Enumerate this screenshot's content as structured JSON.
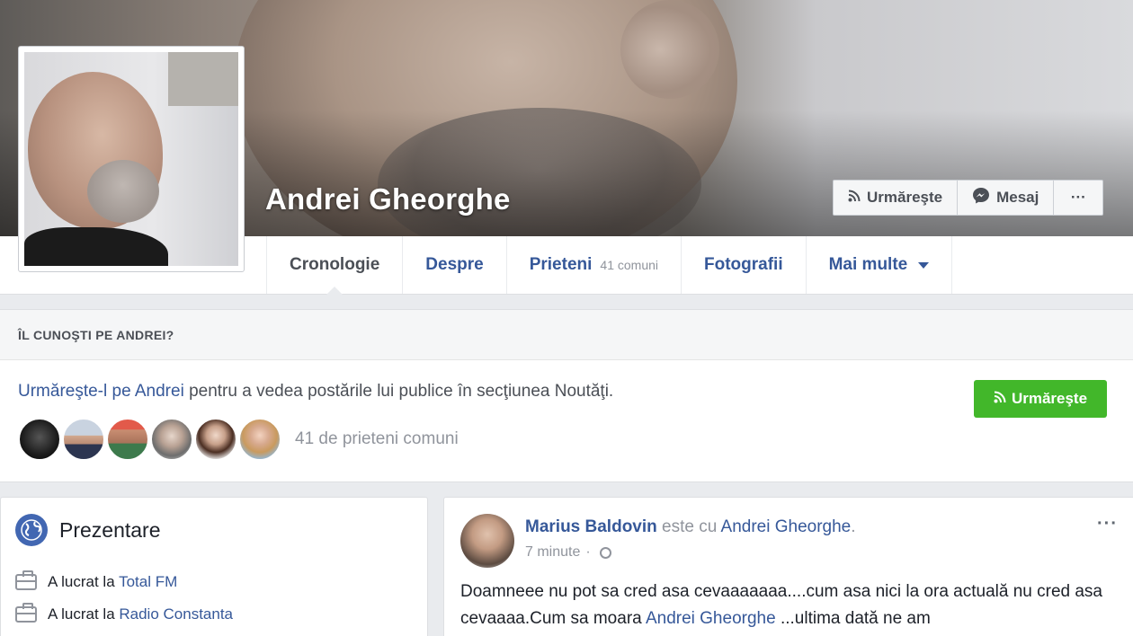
{
  "profile": {
    "name": "Andrei Gheorghe"
  },
  "cover_actions": {
    "follow_label": "Urmăreşte",
    "message_label": "Mesaj",
    "more_label": "···"
  },
  "nav": {
    "tabs": [
      {
        "label": "Cronologie",
        "active": true
      },
      {
        "label": "Despre"
      },
      {
        "label": "Prieteni",
        "sub": "41 comuni"
      },
      {
        "label": "Fotografii"
      },
      {
        "label": "Mai multe"
      }
    ]
  },
  "know_box": {
    "heading": "ÎL CUNOŞTI PE ANDREI?",
    "link_text": "Urmăreşte-l pe Andrei",
    "rest_text": " pentru a vedea postările lui publice în secţiunea Noutăţi.",
    "follow_button": "Urmăreşte",
    "mutual_friends_text": "41 de prieteni comuni"
  },
  "intro": {
    "title": "Prezentare",
    "work": [
      {
        "prefix": "A lucrat la ",
        "place": "Total FM"
      },
      {
        "prefix": "A lucrat la ",
        "place": "Radio Constanta"
      }
    ]
  },
  "post": {
    "author": "Marius Baldovin",
    "with_text": " este cu ",
    "tagged": "Andrei Gheorghe",
    "tagged_suffix": ".",
    "time": "7 minute",
    "separator": "·",
    "more": "···",
    "body_1": "Doamneee nu pot sa cred asa cevaaaaaaa....cum asa nici la ora actuală nu cred asa cevaaaa.Cum sa moara ",
    "body_link": "Andrei Gheorghe",
    "body_2": " ...ultima dată ne am"
  },
  "colors": {
    "link": "#365899",
    "green_button": "#42b72a",
    "background": "#e9ebee",
    "muted": "#90949c"
  },
  "icons": [
    "rss-icon",
    "messenger-icon",
    "more-icon",
    "caret-down-icon",
    "globe-icon",
    "briefcase-icon",
    "public-globe-icon"
  ]
}
